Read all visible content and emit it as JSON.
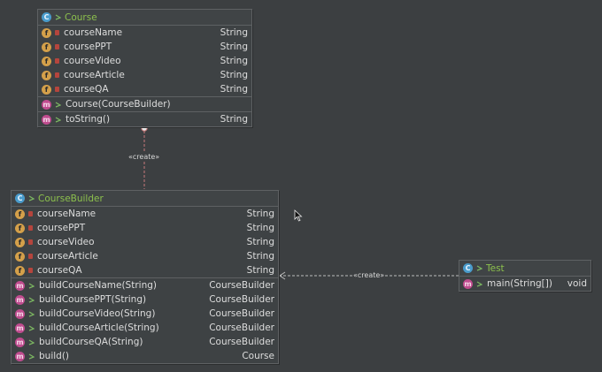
{
  "colors": {
    "background": "#3c3f41",
    "class_title": "#8cc04d",
    "field_badge": "#d4a04a",
    "method_badge": "#c04c8f",
    "class_badge": "#4a9ccc",
    "dependency_line": "#c77a7a"
  },
  "course": {
    "title": "Course",
    "icon": "class-icon",
    "fields": [
      {
        "name": "courseName",
        "type": "String"
      },
      {
        "name": "coursePPT",
        "type": "String"
      },
      {
        "name": "courseVideo",
        "type": "String"
      },
      {
        "name": "courseArticle",
        "type": "String"
      },
      {
        "name": "courseQA",
        "type": "String"
      }
    ],
    "constructors": [
      {
        "name": "Course(CourseBuilder)",
        "type": ""
      }
    ],
    "methods": [
      {
        "name": "toString()",
        "type": "String"
      }
    ]
  },
  "builder": {
    "title": "CourseBuilder",
    "icon": "static-nested-class-icon",
    "fields": [
      {
        "name": "courseName",
        "type": "String"
      },
      {
        "name": "coursePPT",
        "type": "String"
      },
      {
        "name": "courseVideo",
        "type": "String"
      },
      {
        "name": "courseArticle",
        "type": "String"
      },
      {
        "name": "courseQA",
        "type": "String"
      }
    ],
    "methods": [
      {
        "name": "buildCourseName(String)",
        "type": "CourseBuilder"
      },
      {
        "name": "buildCoursePPT(String)",
        "type": "CourseBuilder"
      },
      {
        "name": "buildCourseVideo(String)",
        "type": "CourseBuilder"
      },
      {
        "name": "buildCourseArticle(String)",
        "type": "CourseBuilder"
      },
      {
        "name": "buildCourseQA(String)",
        "type": "CourseBuilder"
      },
      {
        "name": "build()",
        "type": "Course"
      }
    ]
  },
  "test": {
    "title": "Test",
    "icon": "class-icon",
    "methods": [
      {
        "name": "main(String[])",
        "type": "void"
      }
    ]
  },
  "relations": {
    "builder_to_course_label": "«create»",
    "test_to_builder_label": "«create»"
  }
}
